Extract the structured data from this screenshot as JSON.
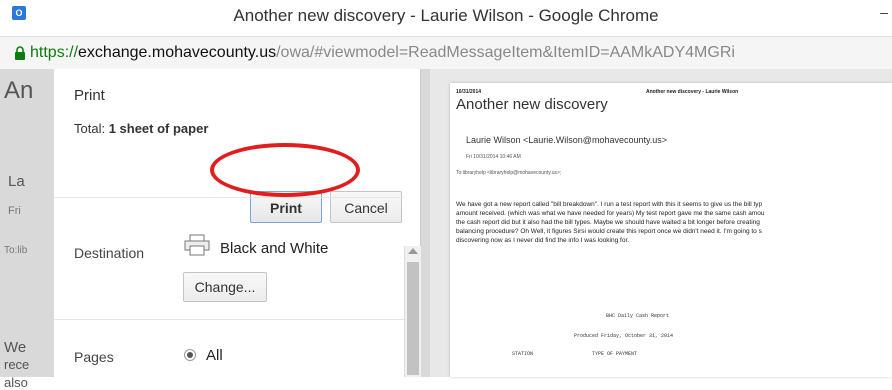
{
  "window": {
    "title": "Another new discovery - Laurie Wilson - Google Chrome",
    "minimize": "‒"
  },
  "address": {
    "scheme": "https://",
    "host": "exchange.mohavecounty.us",
    "path": "/owa/#viewmodel=ReadMessageItem&ItemID=AAMkADY4MGRi"
  },
  "background_page": {
    "subject": "An",
    "from": "La",
    "date": "Fri",
    "to": "To:lib",
    "body": [
      "We",
      "rece",
      "also"
    ]
  },
  "print_dialog": {
    "heading": "Print",
    "total_prefix": "Total: ",
    "total_value": "1 sheet of paper",
    "print_label": "Print",
    "cancel_label": "Cancel",
    "destination_label": "Destination",
    "destination_value": "Black and White",
    "change_label": "Change...",
    "pages_label": "Pages",
    "pages_value": "All"
  },
  "preview": {
    "date": "10/31/2014",
    "header": "Another new discovery - Laurie Wilson",
    "subject": "Another new discovery",
    "from": "Laurie Wilson <Laurie.Wilson@mohavecounty.us>",
    "sent": "Fri 10/31/2014 10:46 AM",
    "to": "To:libraryhelp <libraryhelp@mohavecounty.us>;",
    "body": [
      "We have got a new report called \"bill breakdown\". I run a test report with this it seems to give us the bill typ",
      "amount received. (which was what we have needed for years) My test report gave me the same cash amou",
      "the cash report did but it also had the bill types. Maybe we should have waited a bit longer before creating",
      "balancing procedure? Oh Well, it figures Sirsi would create this report once we didn't need it. I'm going to s",
      "discovering now as I never did find the info I was looking for."
    ],
    "report_title": "BHC Daily Cash Report",
    "report_produced": "Produced Friday, October 31, 2014",
    "col_station": "STATION",
    "col_payment": "TYPE OF PAYMENT"
  },
  "colors": {
    "accent_oval": "#e21d1d",
    "url_secure": "#0f7b0f"
  }
}
